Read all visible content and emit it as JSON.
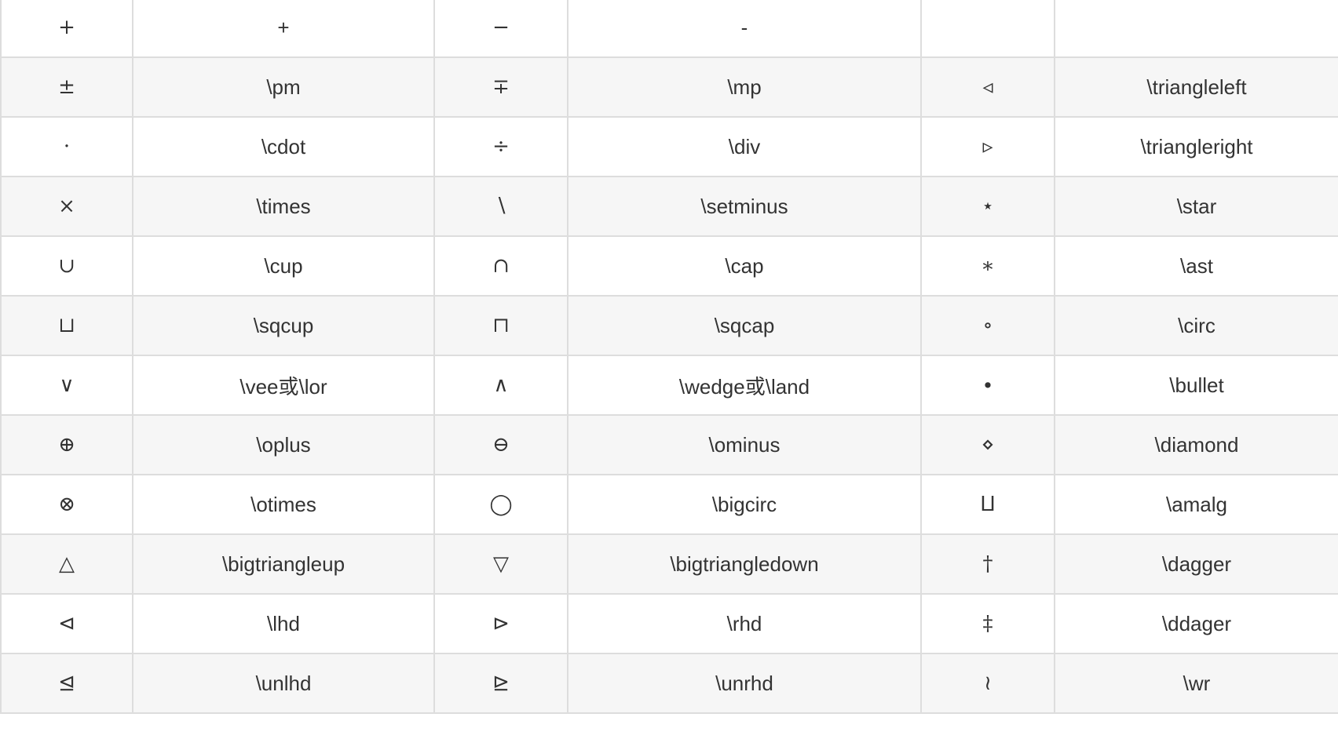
{
  "rows": [
    {
      "s1": "+",
      "c1": "+",
      "s2": "−",
      "c2": "-",
      "s3": "",
      "c3": ""
    },
    {
      "s1": "±",
      "c1": "\\pm",
      "s2": "∓",
      "c2": "\\mp",
      "s3": "◃",
      "c3": "\\triangleleft"
    },
    {
      "s1": "·",
      "c1": "\\cdot",
      "s2": "÷",
      "c2": "\\div",
      "s3": "▹",
      "c3": "\\triangleright"
    },
    {
      "s1": "×",
      "c1": "\\times",
      "s2": "∖",
      "c2": "\\setminus",
      "s3": "⋆",
      "c3": "\\star"
    },
    {
      "s1": "∪",
      "c1": "\\cup",
      "s2": "∩",
      "c2": "\\cap",
      "s3": "∗",
      "c3": "\\ast"
    },
    {
      "s1": "⊔",
      "c1": "\\sqcup",
      "s2": "⊓",
      "c2": "\\sqcap",
      "s3": "∘",
      "c3": "\\circ"
    },
    {
      "s1": "∨",
      "c1": "\\vee或\\lor",
      "s2": "∧",
      "c2": "\\wedge或\\land",
      "s3": "∙",
      "c3": "\\bullet"
    },
    {
      "s1": "⊕",
      "c1": "\\oplus",
      "s2": "⊖",
      "c2": "\\ominus",
      "s3": "⋄",
      "c3": "\\diamond"
    },
    {
      "s1": "⊗",
      "c1": "\\otimes",
      "s2": "◯",
      "c2": "\\bigcirc",
      "s3": "⨿",
      "c3": "\\amalg"
    },
    {
      "s1": "△",
      "c1": "\\bigtriangleup",
      "s2": "▽",
      "c2": "\\bigtriangledown",
      "s3": "†",
      "c3": "\\dagger"
    },
    {
      "s1": "⊲",
      "c1": "\\lhd",
      "s2": "⊳",
      "c2": "\\rhd",
      "s3": "‡",
      "c3": "\\ddager"
    },
    {
      "s1": "⊴",
      "c1": "\\unlhd",
      "s2": "⊵",
      "c2": "\\unrhd",
      "s3": "≀",
      "c3": "\\wr"
    }
  ]
}
